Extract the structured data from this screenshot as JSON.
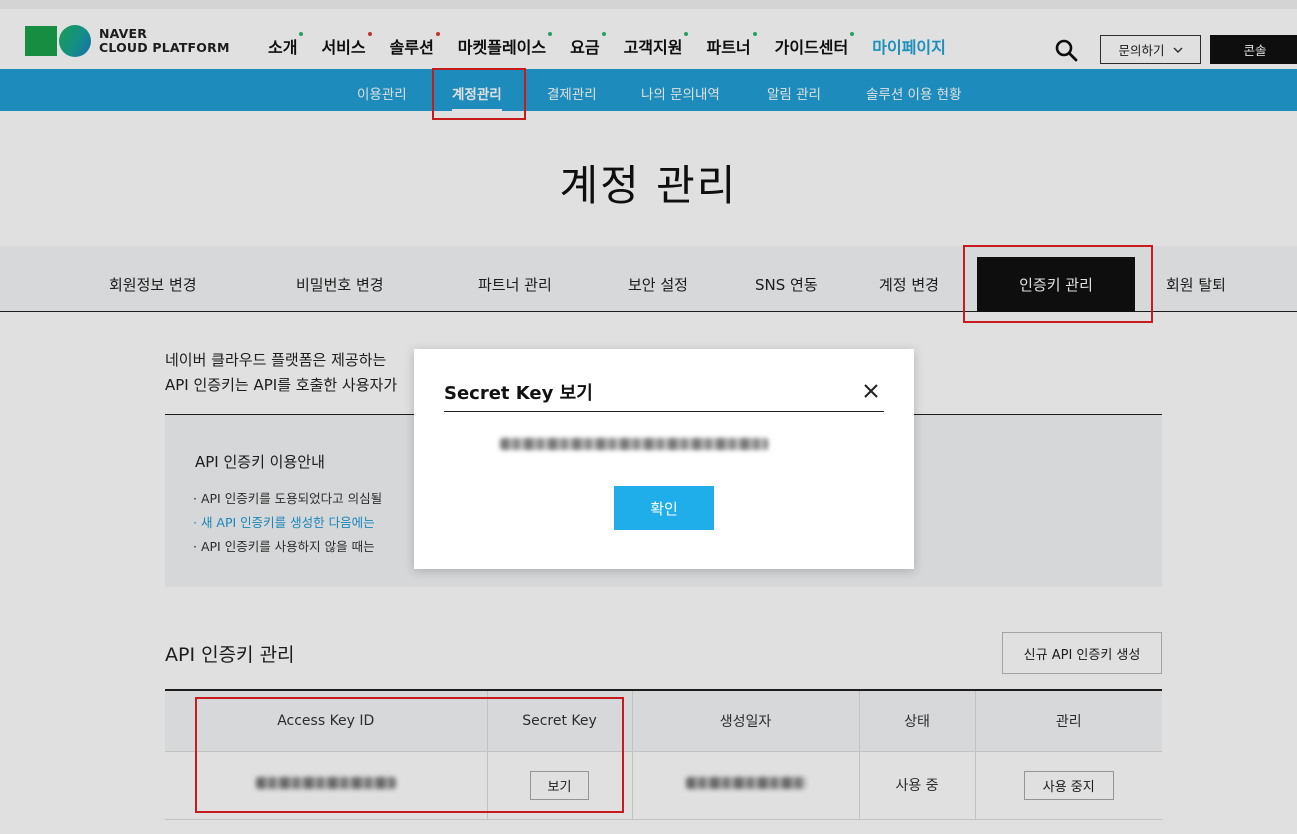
{
  "brand": {
    "line1": "NAVER",
    "line2": "CLOUD PLATFORM"
  },
  "nav": {
    "items": [
      {
        "label": "소개",
        "dot": "#2bb673"
      },
      {
        "label": "서비스",
        "dot": "#e03a3a"
      },
      {
        "label": "솔루션",
        "dot": "#e03a3a"
      },
      {
        "label": "마켓플레이스",
        "dot": "#2bb673"
      },
      {
        "label": "요금",
        "dot": "#2bb673"
      },
      {
        "label": "고객지원",
        "dot": "#2bb673"
      },
      {
        "label": "파트너",
        "dot": "#2bb673"
      },
      {
        "label": "가이드센터",
        "dot": "#2bb673"
      },
      {
        "label": "마이페이지",
        "dot": ""
      }
    ],
    "inquiry_label": "문의하기",
    "console_label": "콘솔"
  },
  "subnav": {
    "items": [
      "이용관리",
      "계정관리",
      "결제관리",
      "나의 문의내역",
      "알림 관리",
      "솔루션 이용 현황"
    ],
    "active": "계정관리"
  },
  "page": {
    "title": "계정 관리"
  },
  "tabs": {
    "items": [
      "회원정보 변경",
      "비밀번호 변경",
      "파트너 관리",
      "보안 설정",
      "SNS 연동",
      "계정 변경",
      "인증키 관리",
      "회원 탈퇴"
    ],
    "active": "인증키 관리"
  },
  "intro": {
    "line1": "네이버 클라우드 플랫폼은 제공하는",
    "line2": "API 인증키는 API를 호출한 사용자가"
  },
  "guide": {
    "title": "API 인증키 이용안내",
    "items": [
      "· API 인증키를 도용되었다고 의심될",
      "· 새 API 인증키를 생성한 다음에는",
      "· API 인증키를 사용하지 않을 때는"
    ]
  },
  "api_keys": {
    "section_title": "API 인증키 관리",
    "new_button": "신규 API 인증키 생성",
    "columns": [
      "Access Key ID",
      "Secret Key",
      "생성일자",
      "상태",
      "관리"
    ],
    "row": {
      "view_button": "보기",
      "status": "사용 중",
      "stop_button": "사용 중지"
    }
  },
  "modal": {
    "title": "Secret Key 보기",
    "confirm_label": "확인"
  },
  "colors": {
    "accent": "#22a0d7",
    "highlight": "#e32020",
    "button": "#1faee9"
  }
}
